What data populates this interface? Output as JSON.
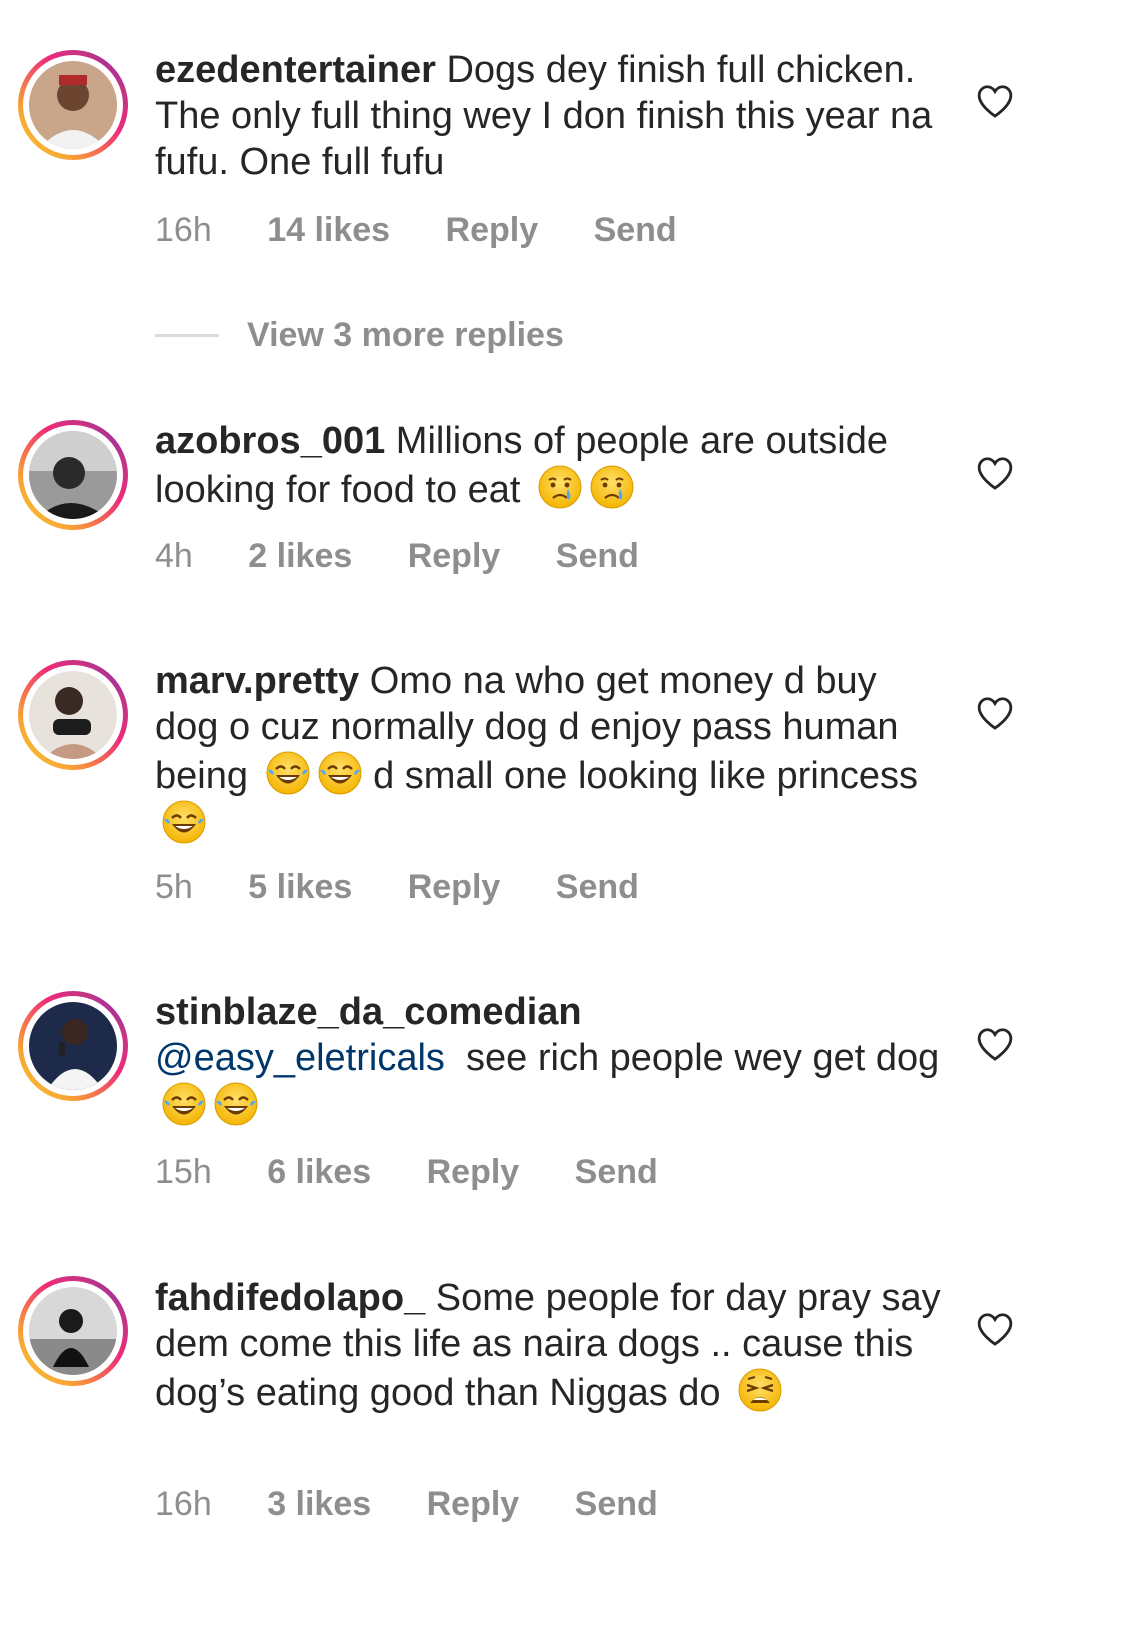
{
  "comments": [
    {
      "username": "ezedentertainer",
      "text": "Dogs dey finish full chicken. The only full thing wey I don finish this year na fufu. One full fufu",
      "time": "16h",
      "likes": "14 likes",
      "reply_label": "Reply",
      "send_label": "Send",
      "emojis": []
    },
    {
      "username": "azobros_001",
      "text": "Millions of people are outside looking for food to eat",
      "time": "4h",
      "likes": "2 likes",
      "reply_label": "Reply",
      "send_label": "Send",
      "emojis": [
        "crying-face",
        "crying-face"
      ]
    },
    {
      "username": "marv.pretty",
      "text": "Omo na who get money d buy dog o cuz normally dog d enjoy pass human being",
      "text_after": "d small one looking like princess",
      "time": "5h",
      "likes": "5 likes",
      "reply_label": "Reply",
      "send_label": "Send",
      "emojis": [
        "tears-of-joy",
        "tears-of-joy",
        "tears-of-joy"
      ]
    },
    {
      "username": "stinblaze_da_comedian",
      "mention": "@easy_eletricals",
      "text": "see rich people wey get dog",
      "time": "15h",
      "likes": "6 likes",
      "reply_label": "Reply",
      "send_label": "Send",
      "emojis": [
        "tears-of-joy",
        "tears-of-joy"
      ]
    },
    {
      "username": "fahdifedolapo_",
      "text": "Some people for day pray say dem come this life as naira dogs .. cause this dog’s eating good than Niggas do",
      "time": "16h",
      "likes": "3 likes",
      "reply_label": "Reply",
      "send_label": "Send",
      "emojis": [
        "weary-face"
      ]
    }
  ],
  "view_replies": "View 3 more replies",
  "colors": {
    "text": "#262626",
    "muted": "#8e8e8e",
    "mention": "#00376b",
    "divider": "#dbdbdb",
    "story_ring": [
      "#f9ce34",
      "#ee2a7b",
      "#6228d7"
    ]
  }
}
